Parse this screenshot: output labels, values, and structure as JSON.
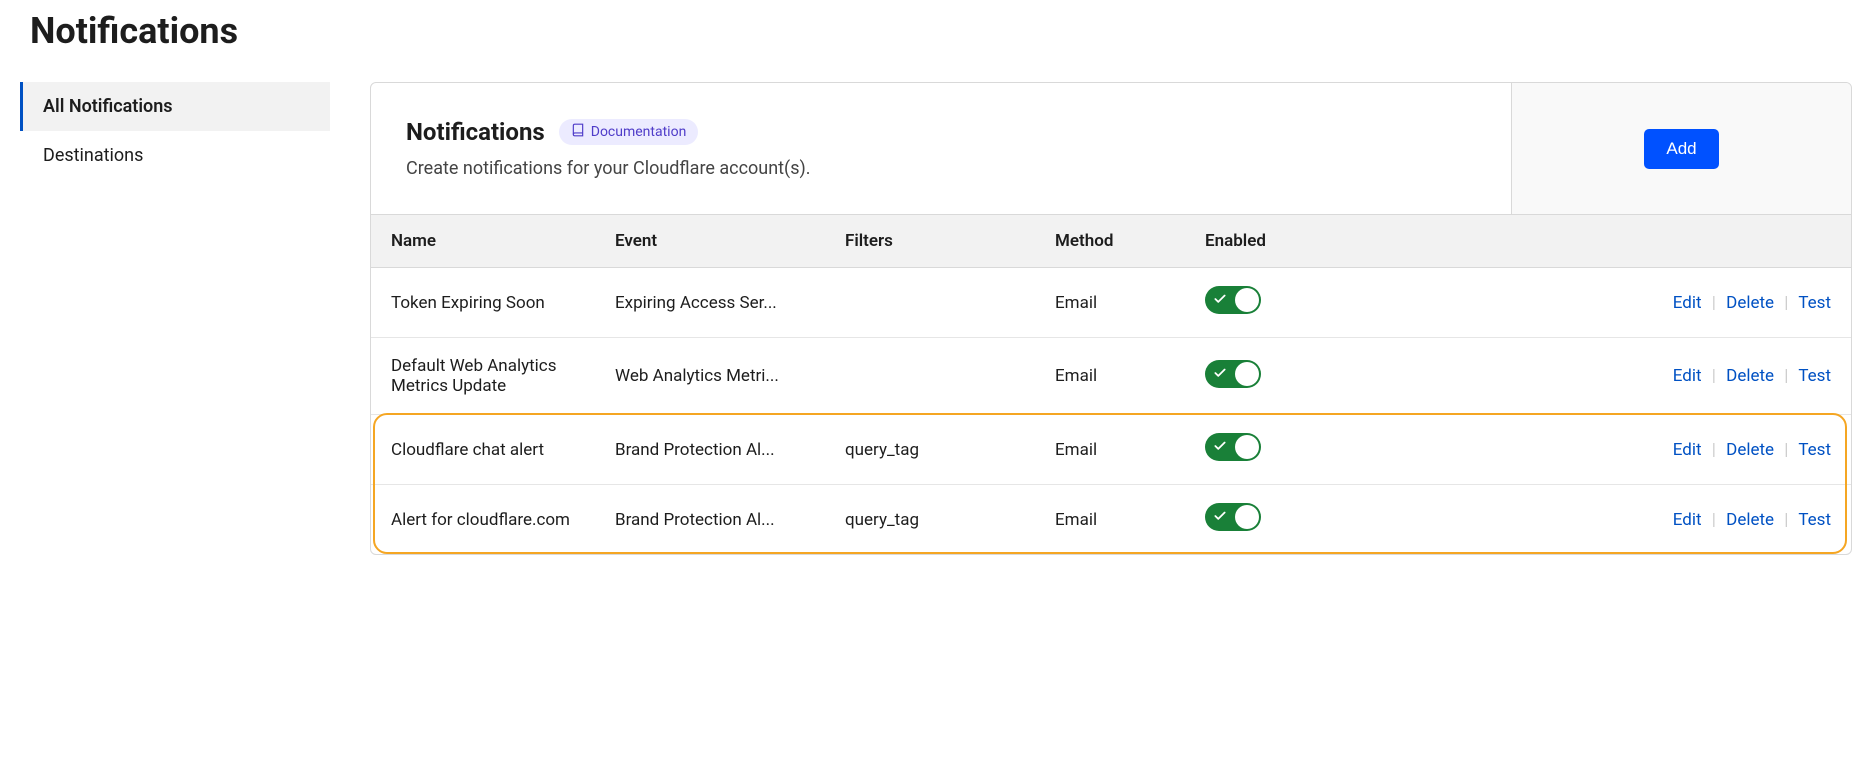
{
  "page": {
    "title": "Notifications"
  },
  "sidebar": {
    "items": [
      {
        "label": "All Notifications",
        "active": true
      },
      {
        "label": "Destinations",
        "active": false
      }
    ]
  },
  "panel": {
    "title": "Notifications",
    "doc_label": "Documentation",
    "subtitle": "Create notifications for your Cloudflare account(s).",
    "add_label": "Add"
  },
  "table": {
    "columns": {
      "name": "Name",
      "event": "Event",
      "filters": "Filters",
      "method": "Method",
      "enabled": "Enabled"
    },
    "actions": {
      "edit": "Edit",
      "delete": "Delete",
      "test": "Test"
    },
    "rows": [
      {
        "name": "Token Expiring Soon",
        "event": "Expiring Access Ser...",
        "filters": "",
        "method": "Email",
        "enabled": true,
        "highlighted": false
      },
      {
        "name": "Default Web Analytics Metrics Update",
        "event": "Web Analytics Metri...",
        "filters": "",
        "method": "Email",
        "enabled": true,
        "highlighted": false
      },
      {
        "name": "Cloudflare chat alert",
        "event": "Brand Protection Al...",
        "filters": "query_tag",
        "method": "Email",
        "enabled": true,
        "highlighted": true
      },
      {
        "name": "Alert for cloudflare.com",
        "event": "Brand Protection Al...",
        "filters": "query_tag",
        "method": "Email",
        "enabled": true,
        "highlighted": true
      }
    ]
  }
}
